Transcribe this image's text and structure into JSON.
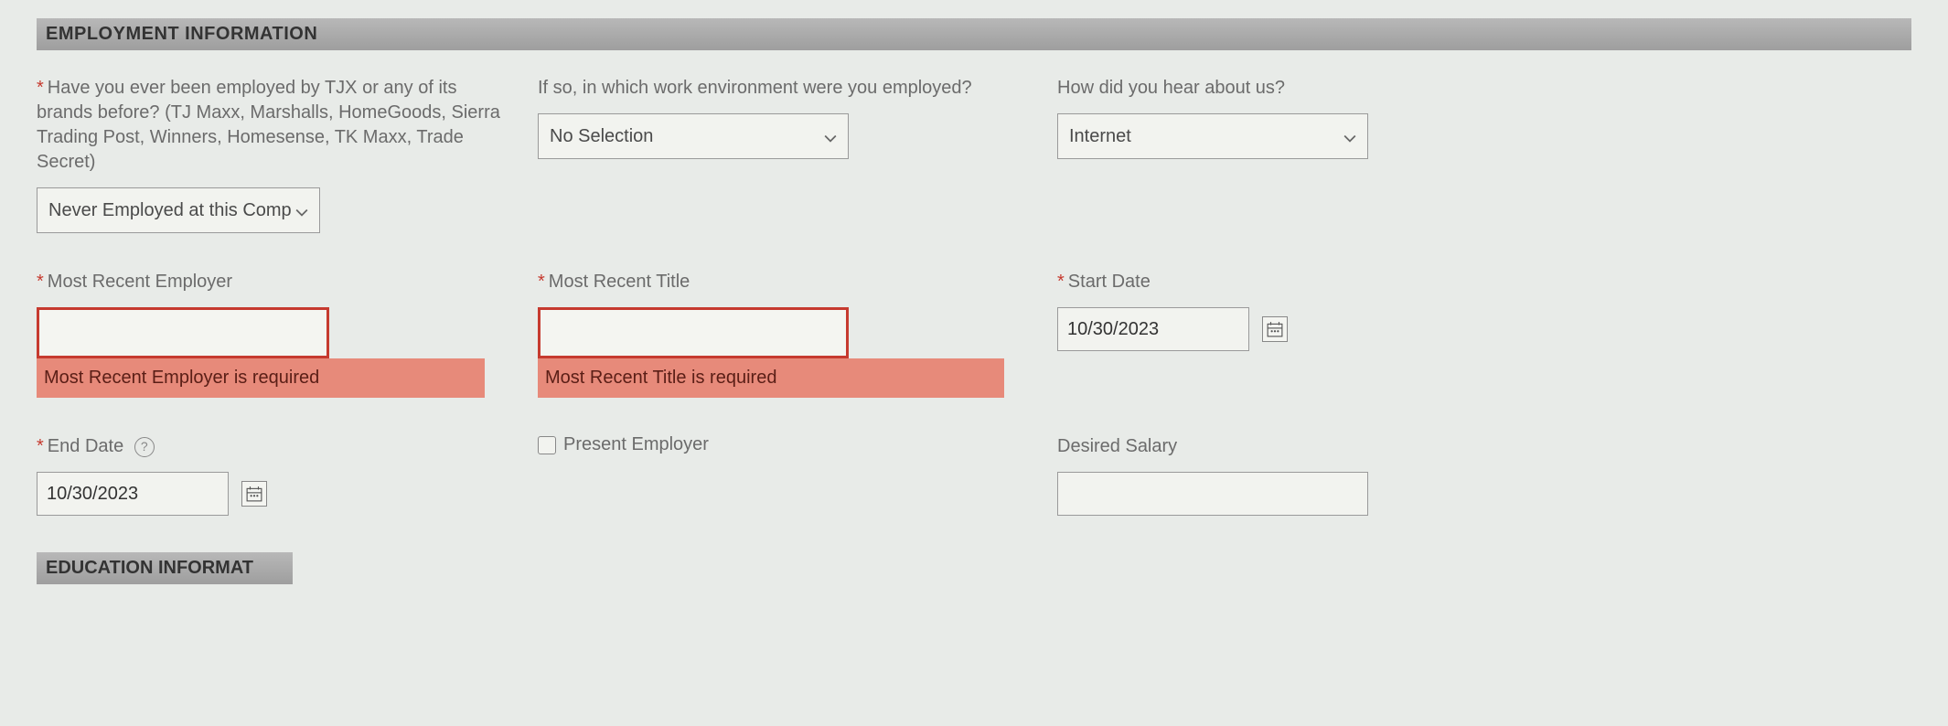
{
  "section": {
    "title": "EMPLOYMENT INFORMATION",
    "next_title": "EDUCATION INFORMAT"
  },
  "fields": {
    "prev_employed": {
      "label": "Have you ever been employed by TJX or any of its brands before? (TJ Maxx, Marshalls, HomeGoods, Sierra Trading Post, Winners, Homesense, TK Maxx, Trade Secret)",
      "value": "Never Employed at this Comp"
    },
    "work_env": {
      "label": "If so, in which work environment were you employed?",
      "value": "No Selection"
    },
    "hear_about": {
      "label": "How did you hear about us?",
      "value": "Internet"
    },
    "recent_employer": {
      "label": "Most Recent Employer",
      "value": "",
      "error": "Most Recent Employer is required"
    },
    "recent_title": {
      "label": "Most Recent Title",
      "value": "",
      "error": "Most Recent Title is required"
    },
    "start_date": {
      "label": "Start Date",
      "value": "10/30/2023"
    },
    "end_date": {
      "label": "End Date",
      "value": "10/30/2023"
    },
    "present_employer": {
      "label": "Present Employer"
    },
    "desired_salary": {
      "label": "Desired Salary",
      "value": ""
    }
  }
}
